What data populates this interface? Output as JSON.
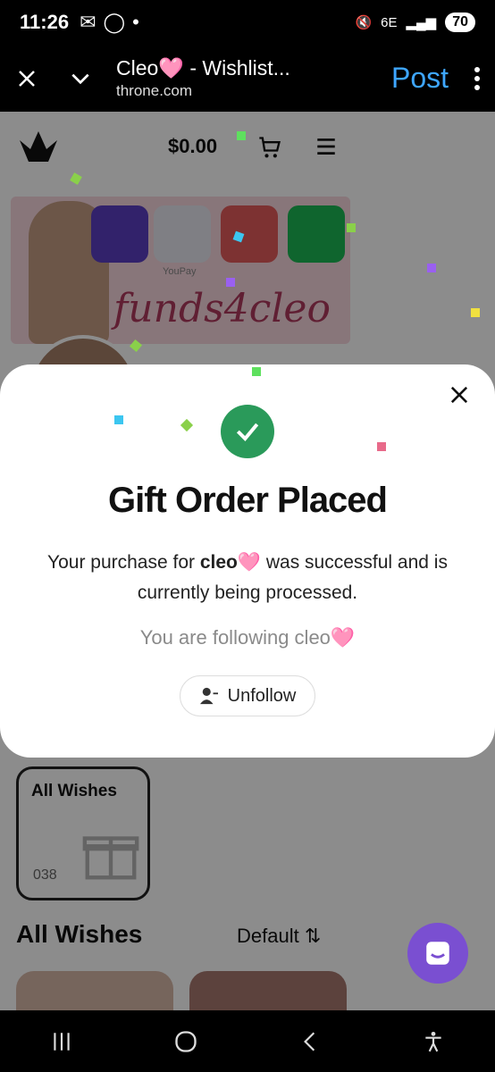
{
  "status": {
    "time": "11:26",
    "network": "6E",
    "battery": "70"
  },
  "browser": {
    "title": "Cleo🩷 - Wishlist...",
    "url": "throne.com",
    "post_label": "Post"
  },
  "site": {
    "cart_total": "$0.00",
    "banner_text": "funds4cleo",
    "banner_caption": "YouPay"
  },
  "modal": {
    "title": "Gift Order Placed",
    "message_prefix": "Your purchase for ",
    "message_name": "cleo🩷",
    "message_suffix": " was successful and is currently being processed.",
    "following_text": "You are following cleo🩷",
    "unfollow_label": "Unfollow"
  },
  "wishlist": {
    "card_label": "All Wishes",
    "card_count": "038",
    "section_title": "All Wishes",
    "sort_label": "Default"
  },
  "icons": [
    "close-icon",
    "chevron-down-icon",
    "more-vert-icon",
    "cart-icon",
    "menu-icon",
    "check-icon",
    "user-minus-icon",
    "gift-icon",
    "sort-icon",
    "chat-icon",
    "recents-icon",
    "home-icon",
    "back-icon",
    "accessibility-icon"
  ],
  "colors": {
    "accent": "#2a9a5a",
    "post": "#3ea6ff",
    "chat": "#7a4fd1"
  }
}
